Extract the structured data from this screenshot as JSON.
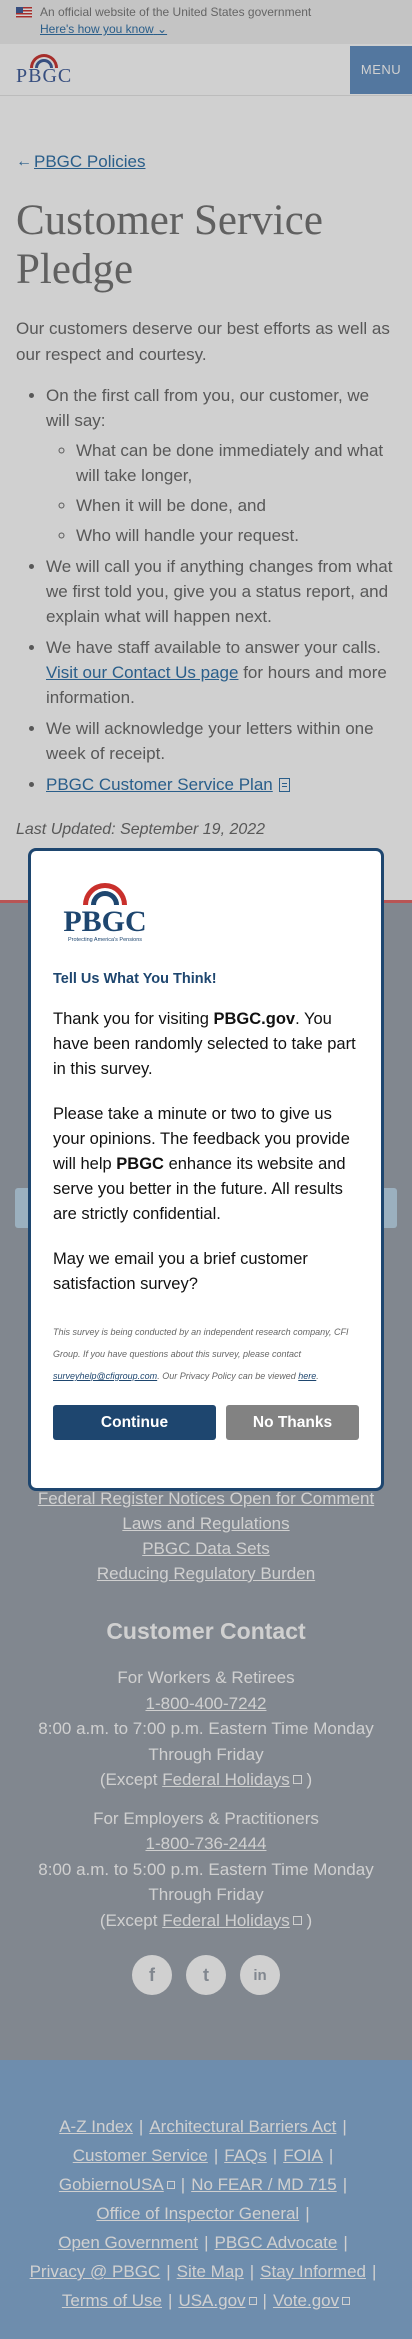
{
  "banner": {
    "official_text": "An official website of the United States government",
    "how_label": "Here's how you know"
  },
  "header": {
    "logo_text": "PBGC",
    "menu_label": "MENU"
  },
  "page": {
    "breadcrumb": "PBGC Policies",
    "title": "Customer Service Pledge",
    "intro": "Our customers deserve our best efforts as well as our respect and courtesy.",
    "items": {
      "first_call": "On the first call from you, our customer, we will say:",
      "sub1": "What can be done immediately and what will take longer,",
      "sub2": "When it will be done, and",
      "sub3": "Who will handle your request.",
      "call_back": "We will call you if anything changes from what we first told you, give you a status report, and explain what will happen next.",
      "staff_pre": "We have staff available to answer your calls.",
      "staff_link": "Visit our Contact Us page",
      "staff_post": "for hours and more information.",
      "letters": "We will acknowledge your letters within one week of receipt.",
      "plan_link": "PBGC Customer Service Plan"
    },
    "last_updated": "Last Updated: September 19, 2022"
  },
  "footer": {
    "links": [
      "Federal Register Notices Open for Comment",
      "Laws and Regulations",
      "PBGC Data Sets",
      "Reducing Regulatory Burden"
    ],
    "contact_title": "Customer Contact",
    "workers_label": "For Workers & Retirees",
    "workers_phone": "1-800-400-7242",
    "workers_hours": "8:00 a.m. to 7:00 p.m. Eastern Time Monday Through Friday",
    "except_pre": "(Except",
    "holidays_link": "Federal Holidays",
    "except_post": ")",
    "employers_label": "For Employers & Practitioners",
    "employers_phone": "1-800-736-2444",
    "employers_hours": "8:00 a.m. to 5:00 p.m. Eastern Time Monday Through Friday",
    "social": [
      "facebook-icon",
      "twitter-icon",
      "linkedin-icon"
    ]
  },
  "footer_bottom": {
    "r1": [
      "A-Z Index",
      "Architectural Barriers Act"
    ],
    "r2": [
      "Customer Service",
      "FAQs",
      "FOIA"
    ],
    "r3": [
      "GobiernoUSA",
      "No FEAR / MD 715"
    ],
    "r4": [
      "Office of Inspector General"
    ],
    "r5": [
      "Open Government",
      "PBGC Advocate"
    ],
    "r6": [
      "Privacy @ PBGC",
      "Site Map",
      "Stay Informed"
    ],
    "r7": [
      "Terms of Use",
      "USA.gov",
      "Vote.gov"
    ],
    "sep": "|"
  },
  "modal": {
    "logo_text": "PBGC",
    "logo_tagline": "Protecting America's Pensions",
    "title": "Tell Us What You Think!",
    "p1_pre": "Thank you for visiting",
    "p1_bold": "PBGC.gov",
    "p1_post": ". You have been randomly selected to take part in this survey.",
    "p2_pre": "Please take a minute or two to give us your opinions. The feedback you provide will help",
    "p2_bold": "PBGC",
    "p2_post": "enhance its website and serve you better in the future. All results are strictly confidential.",
    "p3": "May we email you a brief customer satisfaction survey?",
    "small1": "This survey is being conducted by an independent research company, CFI Group. If you have questions about this survey, please contact",
    "small_email": "surveyhelp@cfigroup.com",
    "small2": ". Our Privacy Policy can be viewed",
    "small_here": "here",
    "continue_label": "Continue",
    "no_label": "No Thanks"
  },
  "colors": {
    "link": "#2b6ea6",
    "navy": "#1e466f",
    "footer_bg": "#9aa2ac",
    "footer_bottom_bg": "#82aad3",
    "accent_red": "#c9302c"
  }
}
